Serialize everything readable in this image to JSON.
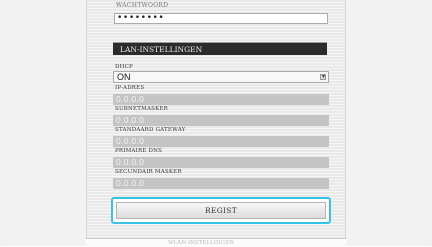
{
  "form": {
    "password_label": "WACHTWOORD",
    "password_value": "••••••••",
    "section_title": "LAN-INSTELLINGEN",
    "dhcp": {
      "label": "DHCP",
      "value": "ON"
    },
    "ip_address": {
      "label": "IP-ADRES",
      "value": "0.0.0.0"
    },
    "subnet_mask": {
      "label": "SUBNETMASKER",
      "value": "0.0.0.0"
    },
    "default_gateway": {
      "label": "STANDAARD GATEWAY",
      "value": "0.0.0.0"
    },
    "primary_dns": {
      "label": "PRIMAIRE DNS",
      "value": "0.0.0.0"
    },
    "secondary_dns": {
      "label": "SECUNDAIR MASKER",
      "value": "0.0.0.0"
    },
    "submit_label": "REGIST",
    "next_section_label": "WLAN-INSTELLINGEN"
  },
  "colors": {
    "header_bg": "#2b2b2b",
    "focus_ring": "#37c3e6",
    "field_bg": "#c4c4c4"
  },
  "icons": {
    "select_arrow": "chevron-down-icon"
  }
}
